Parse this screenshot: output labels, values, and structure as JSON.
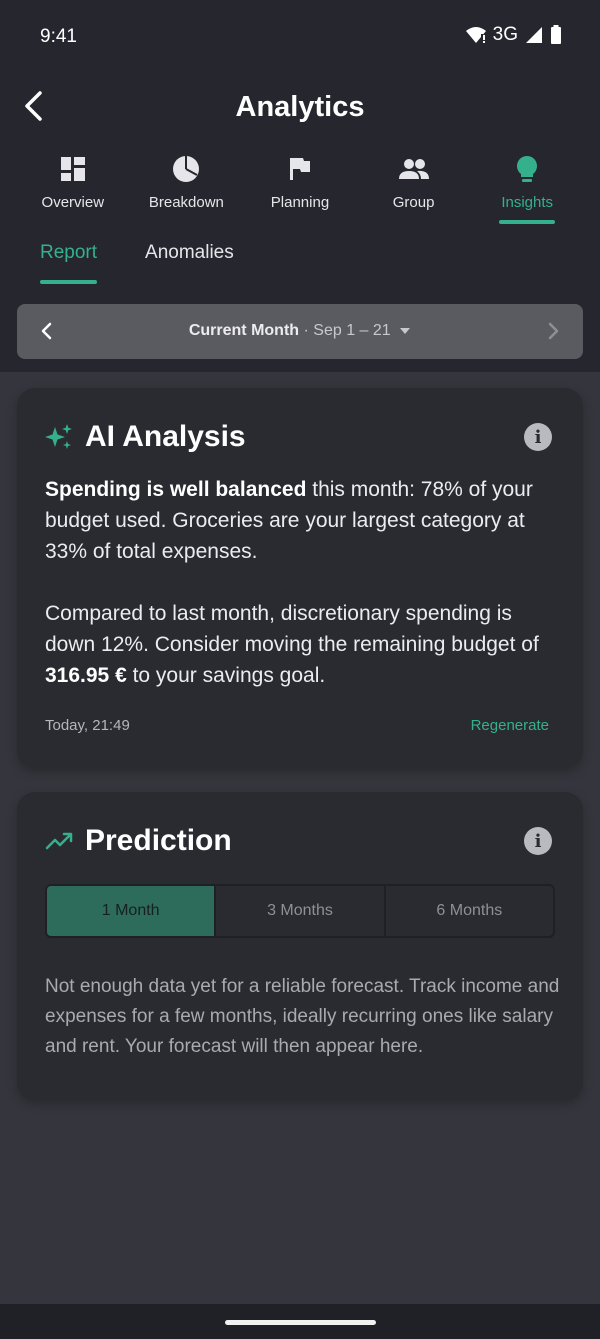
{
  "status": {
    "time": "9:41",
    "network": "3G"
  },
  "header": {
    "title": "Analytics"
  },
  "tabs": [
    {
      "label": "Overview",
      "icon": "dashboard-icon"
    },
    {
      "label": "Breakdown",
      "icon": "pie-chart-icon"
    },
    {
      "label": "Planning",
      "icon": "flag-icon"
    },
    {
      "label": "Group",
      "icon": "group-icon"
    },
    {
      "label": "Insights",
      "icon": "lightbulb-icon",
      "active": true
    }
  ],
  "subtabs": [
    {
      "label": "Report",
      "active": true
    },
    {
      "label": "Anomalies"
    }
  ],
  "period": {
    "label": "Current Month",
    "separator": "·",
    "range": "Sep 1 – 21"
  },
  "ai_analysis": {
    "title": "AI Analysis",
    "p1_bold": "Spending is well balanced",
    "p1_rest": " this month: 78% of your budget used. Groceries are your largest category at 33% of total expenses.",
    "p2_start": "Compared to last month, discretionary spending is down 12%. Consider moving the remaining budget of ",
    "p2_bold": "316.95 €",
    "p2_end": " to your savings goal.",
    "timestamp": "Today, 21:49",
    "regenerate_label": "Regenerate"
  },
  "prediction": {
    "title": "Prediction",
    "options": [
      "1 Month",
      "3 Months",
      "6 Months"
    ],
    "selected": "1 Month",
    "message": "Not enough data yet for a reliable forecast. Track income and expenses for a few months, ideally recurring ones like salary and rent. Your forecast will then appear here."
  },
  "colors": {
    "accent": "#35b08c",
    "background": "#26272e",
    "card": "#2a2b31"
  }
}
